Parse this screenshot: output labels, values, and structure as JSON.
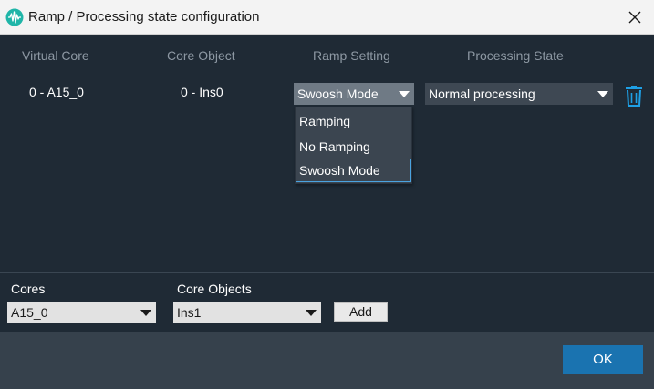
{
  "window": {
    "title": "Ramp / Processing state configuration",
    "app_icon": "waveform-icon",
    "close_icon": "close-icon"
  },
  "table": {
    "columns": [
      "Virtual Core",
      "Core Object",
      "Ramp Setting",
      "Processing State"
    ],
    "rows": [
      {
        "virtual_core": "0 - A15_0",
        "core_object": "0 - Ins0",
        "ramp_setting": "Swoosh Mode",
        "processing_state": "Normal processing",
        "delete_icon": "trash-icon"
      }
    ]
  },
  "ramp_dropdown": {
    "options": [
      "Ramping",
      "No Ramping",
      "Swoosh Mode"
    ],
    "selected": "Swoosh Mode"
  },
  "add_section": {
    "cores_label": "Cores",
    "cores_value": "A15_0",
    "core_objects_label": "Core Objects",
    "core_objects_value": "Ins1",
    "add_label": "Add"
  },
  "footer": {
    "ok_label": "OK"
  },
  "colors": {
    "background": "#1f2a35",
    "footer": "#36414c",
    "accent": "#1a73b0",
    "trash_icon": "#1ea0e6"
  }
}
